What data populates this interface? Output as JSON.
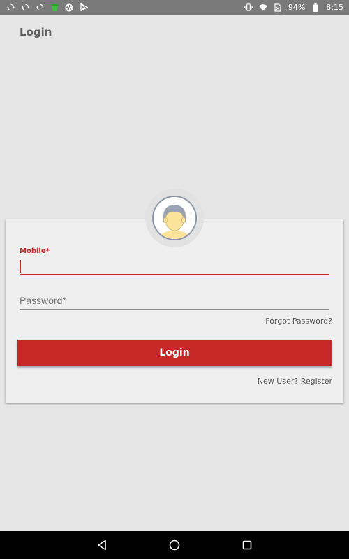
{
  "status_bar": {
    "battery_percent": "94%",
    "time": "8:15",
    "left_icons": [
      "sync-icon",
      "sync-icon",
      "sync-icon",
      "bucket-icon",
      "pinwheel-icon",
      "play-store-icon"
    ],
    "right_icons": [
      "vibrate-icon",
      "wifi-icon",
      "no-sim-icon",
      "battery-icon"
    ]
  },
  "page": {
    "title": "Login"
  },
  "form": {
    "mobile_label": "Mobile*",
    "mobile_value": "",
    "password_placeholder": "Password*",
    "forgot_password": "Forgot Password?",
    "login_button": "Login",
    "register_link": "New User? Register"
  },
  "colors": {
    "accent": "#c62828",
    "background": "#e6e6e6",
    "card": "#efefef",
    "status_bar": "#7a7a7a"
  },
  "nav_bar": {
    "buttons": [
      "back-icon",
      "home-icon",
      "recents-icon"
    ]
  }
}
